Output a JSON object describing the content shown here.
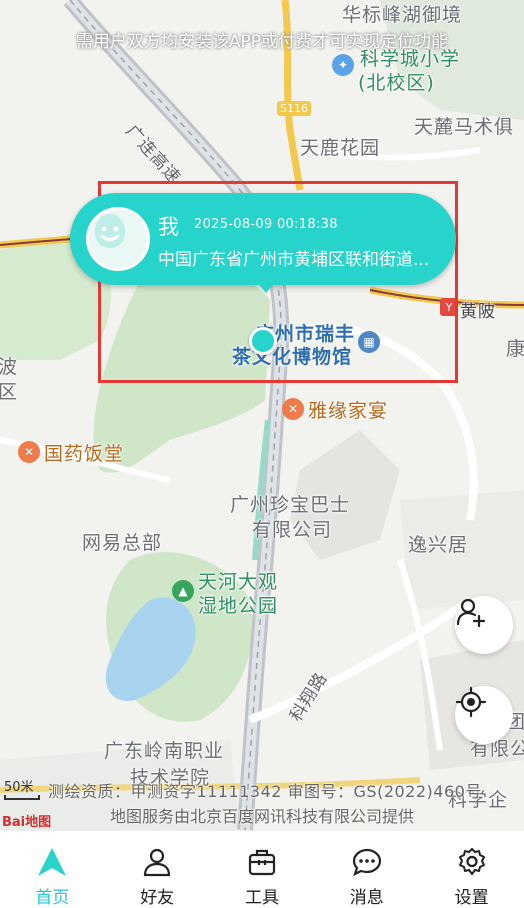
{
  "colors": {
    "accent": "#26d4cc",
    "highlight_box": "#e53935",
    "tab_active": "#26c6da"
  },
  "map": {
    "notice": "需用户双方均安装该APP或付费才可实现定位功能",
    "labels": {
      "huabiao": "华标峰湖御境",
      "kexuecheng_1": "科学城小学",
      "kexuecheng_2": "(北校区)",
      "road_gz": "广连高速",
      "s116": "S116",
      "tianlu_huayuan": "天鹿花园",
      "tianlu_mashu": "天麓马术俱",
      "huangpi": "黄陂",
      "ruifeng_1": "广州市瑞丰",
      "ruifeng_2": "茶文化博物馆",
      "yayuan": "雅缘家宴",
      "guoyao": "国药饭堂",
      "bo": "波",
      "qu": "区",
      "zhenbao_1": "广州珍宝巴士",
      "zhenbao_2": "有限公司",
      "wangyi": "网易总部",
      "yixing": "逸兴居",
      "tianhe_1": "天河大观",
      "tianhe_2": "湿地公园",
      "kexiang": "科翔路",
      "lingnan_1": "广东岭南职业",
      "lingnan_2": "技术学院",
      "right_edge_1": "康",
      "right_edge_2": "团",
      "right_edge_3": "有限公",
      "right_edge_4": "科学企"
    },
    "scale_text": "50米",
    "copyright_line1": "测绘资质：甲测资字11111342  审图号：GS(2022)460号",
    "copyright_line2": "地图服务由北京百度网讯科技有限公司提供",
    "baidu_logo": "Bai地图"
  },
  "callout": {
    "name": "我",
    "time": "2025-08-09 00:18:38",
    "address": "中国广东省广州市黄埔区联和街道..."
  },
  "fabs": {
    "add_friend": "add-friend-icon",
    "locate": "locate-icon"
  },
  "tabs": [
    {
      "label": "首页",
      "icon": "home-arrow-icon",
      "active": true
    },
    {
      "label": "好友",
      "icon": "person-icon",
      "active": false
    },
    {
      "label": "工具",
      "icon": "toolbox-icon",
      "active": false
    },
    {
      "label": "消息",
      "icon": "chat-bubble-icon",
      "active": false
    },
    {
      "label": "设置",
      "icon": "gear-icon",
      "active": false
    }
  ]
}
